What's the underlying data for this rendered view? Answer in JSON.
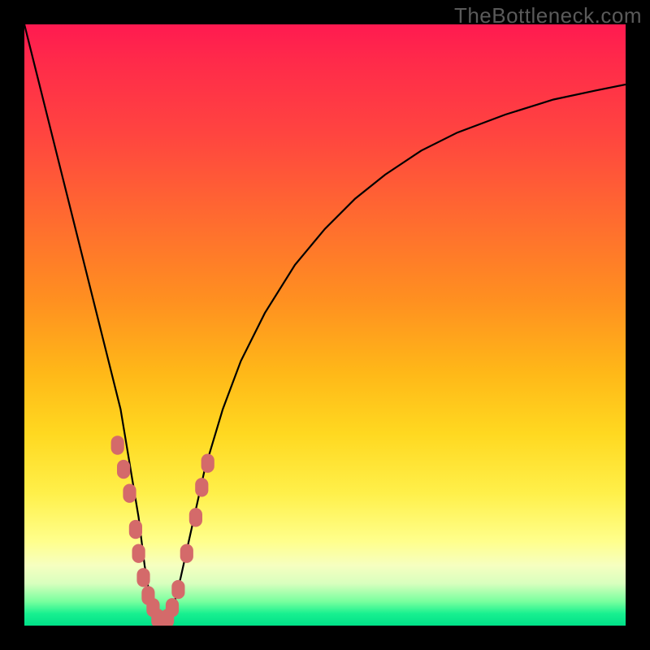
{
  "watermark": "TheBottleneck.com",
  "chart_data": {
    "type": "line",
    "title": "",
    "xlabel": "",
    "ylabel": "",
    "xlim": [
      0,
      100
    ],
    "ylim": [
      0,
      100
    ],
    "grid": false,
    "gradient_stops": [
      {
        "pct": 0,
        "color": "#ff1a50"
      },
      {
        "pct": 6,
        "color": "#ff2a4a"
      },
      {
        "pct": 18,
        "color": "#ff4440"
      },
      {
        "pct": 32,
        "color": "#ff6a30"
      },
      {
        "pct": 46,
        "color": "#ff9020"
      },
      {
        "pct": 58,
        "color": "#ffb818"
      },
      {
        "pct": 68,
        "color": "#ffd820"
      },
      {
        "pct": 78,
        "color": "#fff04a"
      },
      {
        "pct": 86,
        "color": "#ffff8c"
      },
      {
        "pct": 90,
        "color": "#f6ffc0"
      },
      {
        "pct": 93,
        "color": "#d8ffbe"
      },
      {
        "pct": 96,
        "color": "#78ff9e"
      },
      {
        "pct": 98,
        "color": "#18f090"
      },
      {
        "pct": 100,
        "color": "#00e088"
      }
    ],
    "series": [
      {
        "name": "bottleneck-curve",
        "color": "#000000",
        "x": [
          0,
          2,
          4,
          6,
          8,
          10,
          12,
          14,
          16,
          18,
          19,
          20,
          21,
          22,
          23,
          24,
          25,
          26,
          28,
          30,
          33,
          36,
          40,
          45,
          50,
          55,
          60,
          66,
          72,
          80,
          88,
          95,
          100
        ],
        "y": [
          100,
          92,
          84,
          76,
          68,
          60,
          52,
          44,
          36,
          24,
          18,
          10,
          4,
          1,
          0,
          1,
          4,
          8,
          17,
          26,
          36,
          44,
          52,
          60,
          66,
          71,
          75,
          79,
          82,
          85,
          87.5,
          89,
          90
        ]
      }
    ],
    "markers": {
      "name": "highlight-points",
      "color": "#d46a6a",
      "radius_px": 9,
      "points": [
        {
          "x": 15.5,
          "y": 30
        },
        {
          "x": 16.5,
          "y": 26
        },
        {
          "x": 17.5,
          "y": 22
        },
        {
          "x": 18.5,
          "y": 16
        },
        {
          "x": 19,
          "y": 12
        },
        {
          "x": 19.8,
          "y": 8
        },
        {
          "x": 20.6,
          "y": 5
        },
        {
          "x": 21.4,
          "y": 3
        },
        {
          "x": 22.2,
          "y": 1.2
        },
        {
          "x": 23,
          "y": 0.6
        },
        {
          "x": 23.8,
          "y": 1.2
        },
        {
          "x": 24.6,
          "y": 3
        },
        {
          "x": 25.6,
          "y": 6
        },
        {
          "x": 27,
          "y": 12
        },
        {
          "x": 28.5,
          "y": 18
        },
        {
          "x": 29.5,
          "y": 23
        },
        {
          "x": 30.5,
          "y": 27
        }
      ]
    }
  }
}
